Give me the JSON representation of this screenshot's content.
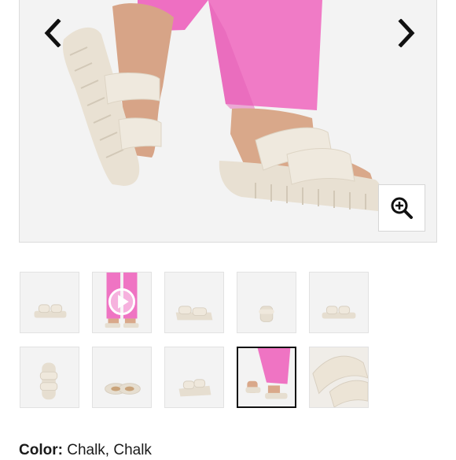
{
  "gallery": {
    "hero_alt": "Chalk platform slide sandal worn with pink pants",
    "prev_icon": "chevron-left-icon",
    "next_icon": "chevron-right-icon",
    "zoom_icon": "zoom-in-icon",
    "thumbnails": [
      {
        "view": "side-pair"
      },
      {
        "view": "video",
        "icon": "play-icon"
      },
      {
        "view": "pair-angle"
      },
      {
        "view": "front"
      },
      {
        "view": "side-pair-2"
      },
      {
        "view": "top-down"
      },
      {
        "view": "soles"
      },
      {
        "view": "three-quarter"
      },
      {
        "view": "on-foot",
        "selected": true
      },
      {
        "view": "close-up"
      }
    ]
  },
  "product": {
    "color_label": "Color:",
    "color_value": " Chalk, Chalk"
  },
  "colors": {
    "sandal": "#ede6da",
    "pant": "#ef74c3",
    "skin": "#d9a88a",
    "arrow": "#111111"
  }
}
